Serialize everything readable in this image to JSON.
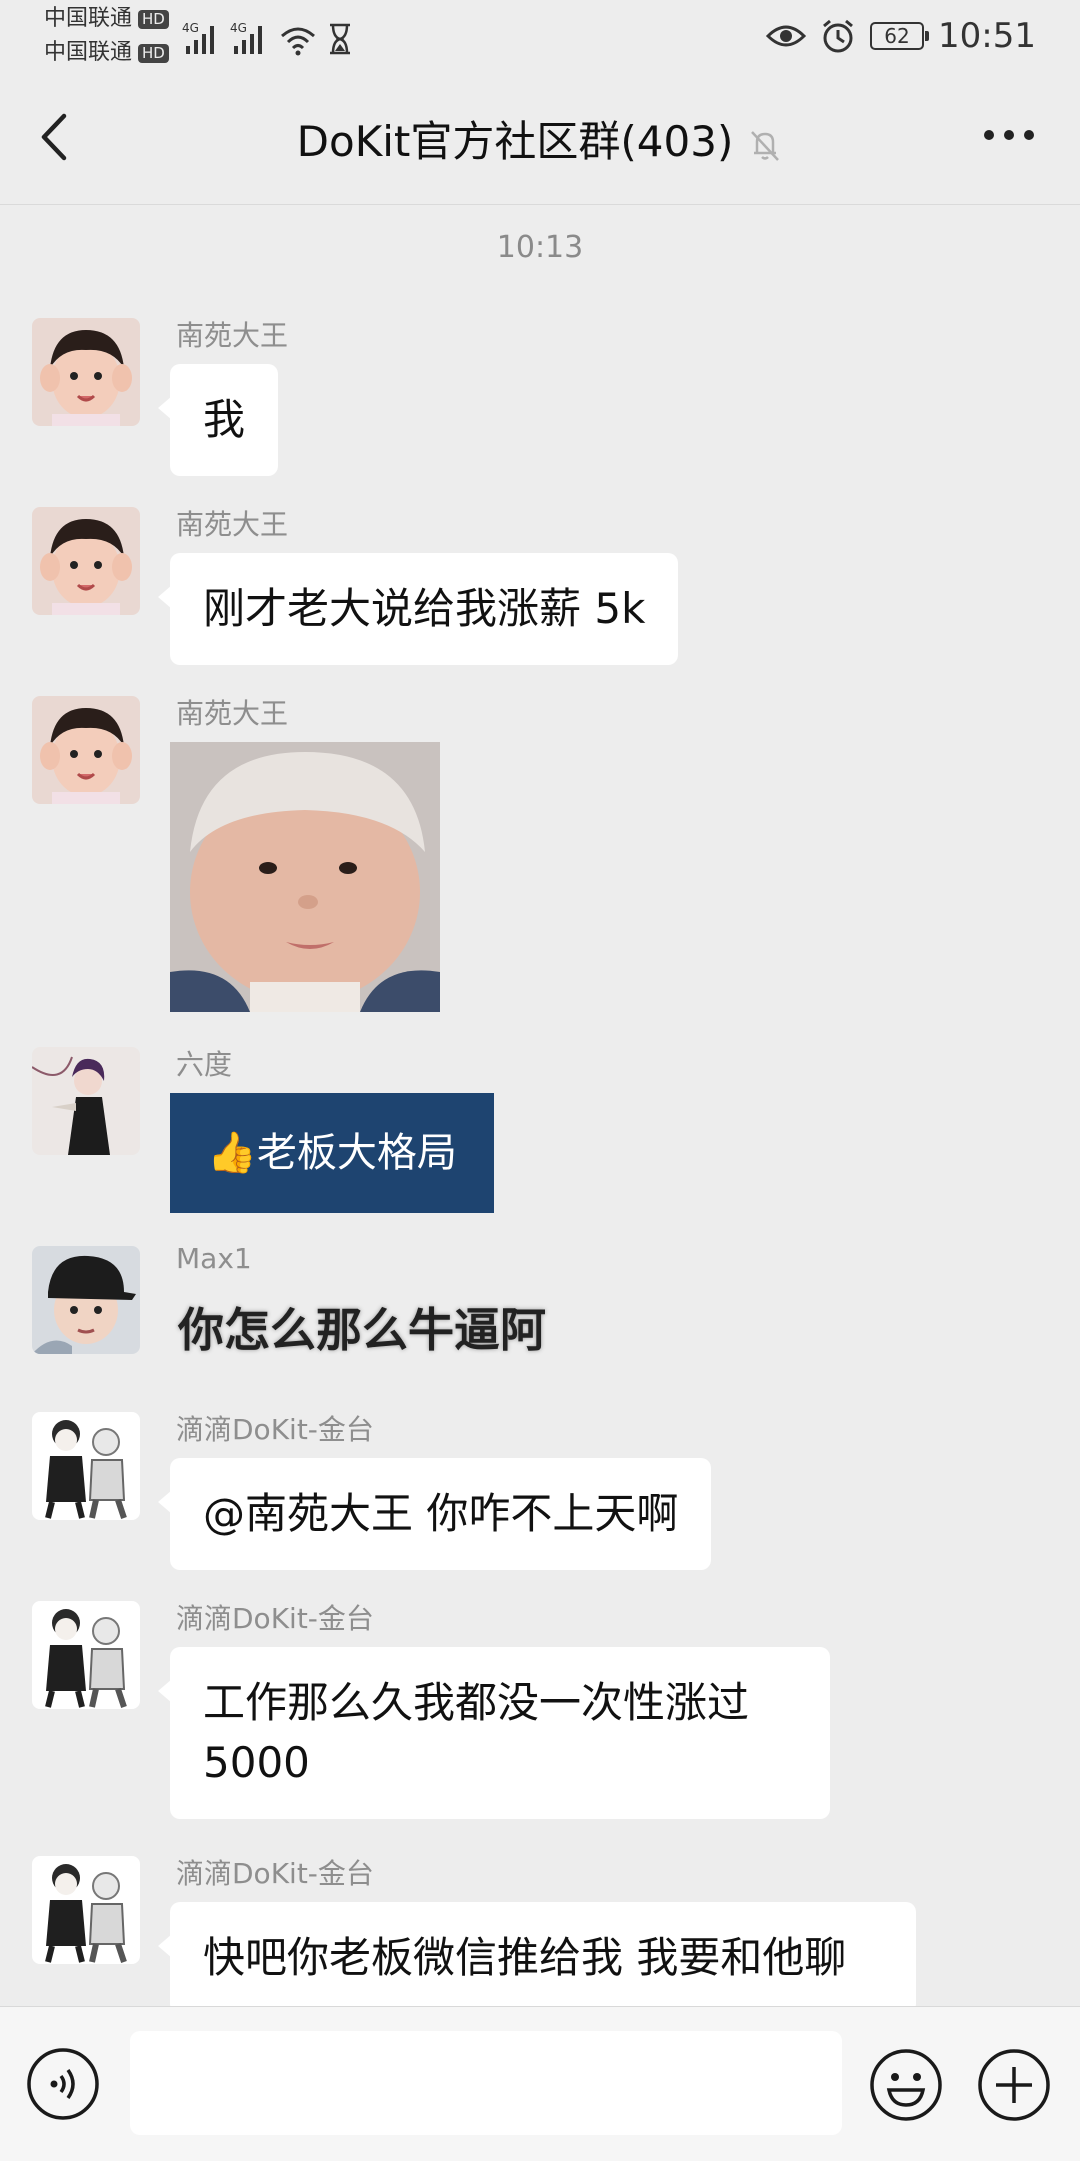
{
  "status_bar": {
    "carrier1": "中国联通",
    "carrier2": "中国联通",
    "hd_badge": "HD",
    "network1": "4G",
    "network2": "4G",
    "battery": "62",
    "time": "10:51"
  },
  "nav": {
    "title": "DoKit官方社区群(403)"
  },
  "chat": {
    "time_divider": "10:13",
    "messages": [
      {
        "sender": "南苑大王",
        "text": "我"
      },
      {
        "sender": "南苑大王",
        "text": "刚才老大说给我涨薪 5k"
      },
      {
        "sender": "南苑大王"
      },
      {
        "sender": "六度",
        "sticker_text": "👍老板大格局"
      },
      {
        "sender": "Max1",
        "sticker_text": "你怎么那么牛逼阿"
      },
      {
        "sender": "滴滴DoKit-金台",
        "text": "@南苑大王  你咋不上天啊"
      },
      {
        "sender": "滴滴DoKit-金台",
        "text": "工作那么久我都没一次性涨过5000"
      },
      {
        "sender": "滴滴DoKit-金台",
        "text": "快吧你老板微信推给我 我要和他聊"
      }
    ]
  },
  "colors": {
    "background": "#ededed",
    "bubble": "#ffffff",
    "sticker_blue": "#1e4470"
  }
}
